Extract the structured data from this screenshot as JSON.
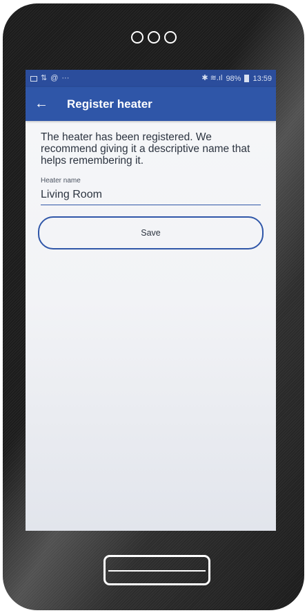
{
  "status_bar": {
    "left_icons": [
      "image-icon",
      "transfer-icon",
      "mail-icon",
      "more-icon"
    ],
    "overflow_text": "···",
    "signal_text": "✱ ≋.ıl",
    "battery_percent": "98%",
    "time": "13:59"
  },
  "app_bar": {
    "back_glyph": "←",
    "title": "Register heater"
  },
  "content": {
    "message": "The heater has been registered. We recommend giving it a descriptive name that helps remembering it.",
    "field_label": "Heater name",
    "field_value": "Living Room",
    "save_label": "Save"
  },
  "colors": {
    "primary": "#2f56a8",
    "status_bar": "#2b4d9c",
    "phone_body": "#1c1c1c"
  }
}
